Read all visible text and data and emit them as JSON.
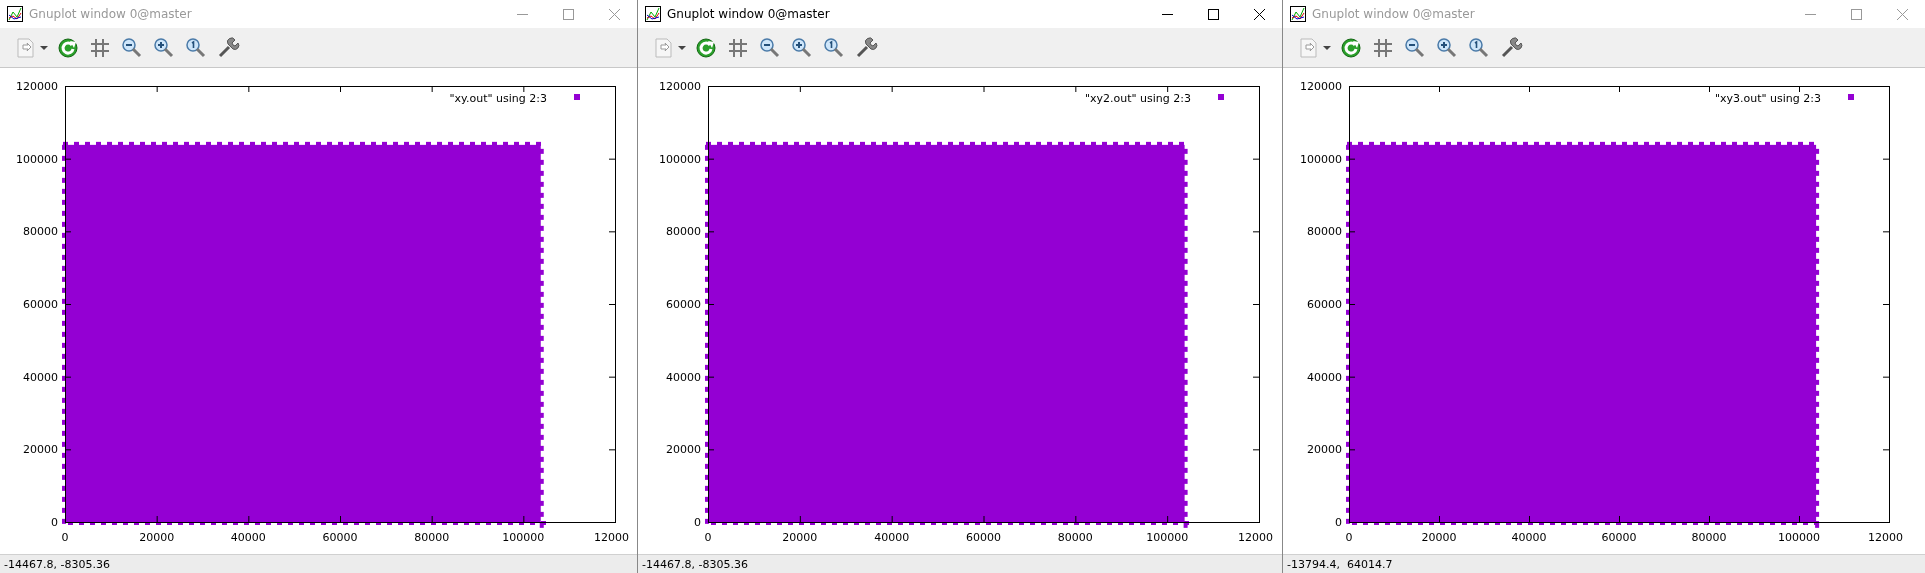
{
  "windows": [
    {
      "title": "Gnuplot window 0@master",
      "active": false,
      "status": "-14467.8, -8305.36",
      "plot": {
        "x_ticks": [
          "0",
          "20000",
          "40000",
          "60000",
          "80000",
          "100000",
          "12000"
        ],
        "y_ticks": [
          "120000",
          "100000",
          "80000",
          "60000",
          "40000",
          "20000",
          "0"
        ],
        "legend": "\"xy.out\" using 2:3"
      }
    },
    {
      "title": "Gnuplot window 0@master",
      "active": true,
      "status": "-14467.8, -8305.36",
      "plot": {
        "x_ticks": [
          "0",
          "20000",
          "40000",
          "60000",
          "80000",
          "100000",
          "12000"
        ],
        "y_ticks": [
          "120000",
          "100000",
          "80000",
          "60000",
          "40000",
          "20000",
          "0"
        ],
        "legend": "\"xy2.out\" using 2:3"
      }
    },
    {
      "title": "Gnuplot window 0@master",
      "active": false,
      "status": "-13794.4,  64014.7",
      "plot": {
        "x_ticks": [
          "0",
          "20000",
          "40000",
          "60000",
          "80000",
          "100000",
          "12000"
        ],
        "y_ticks": [
          "120000",
          "100000",
          "80000",
          "60000",
          "40000",
          "20000",
          "0"
        ],
        "legend": "\"xy3.out\" using 2:3"
      }
    }
  ]
}
